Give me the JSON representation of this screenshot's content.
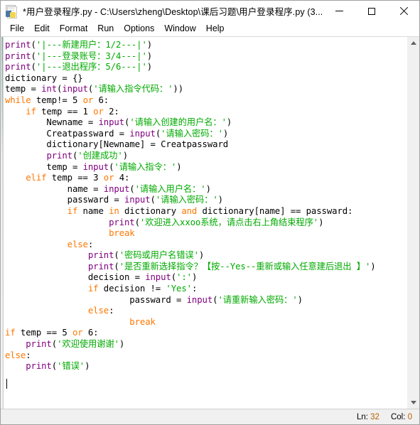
{
  "window": {
    "title": "*用户登录程序.py - C:\\Users\\zheng\\Desktop\\课后习题\\用户登录程序.py (3...",
    "icon": "python-file-icon",
    "controls": {
      "minimize": "minimize-icon",
      "maximize": "maximize-icon",
      "close": "close-icon"
    }
  },
  "menubar": {
    "items": [
      {
        "label": "File"
      },
      {
        "label": "Edit"
      },
      {
        "label": "Format"
      },
      {
        "label": "Run"
      },
      {
        "label": "Options"
      },
      {
        "label": "Window"
      },
      {
        "label": "Help"
      }
    ]
  },
  "editor": {
    "code_lines": [
      "print('|---新建用户：1/2---|')",
      "print('|---登录账号：3/4---|')",
      "print('|---退出程序：5/6---|')",
      "dictionary = {}",
      "temp = int(input('请输入指令代码：'))",
      "while temp!= 5 or 6:",
      "    if temp == 1 or 2:",
      "        Newname = input('请输入创建的用户名：')",
      "        Creatpassward = input('请输入密码：')",
      "        dictionary[Newname] = Creatpassward",
      "        print('创建成功')",
      "        temp = input('请输入指令：')",
      "    elif temp == 3 or 4:",
      "            name = input('请输入用户名：')",
      "            passward = input('请输入密码：')",
      "            if name in dictionary and dictionary[name] == passward:",
      "                    print('欢迎进入xxoo系统，请点击右上角结束程序')",
      "                    break",
      "            else:",
      "                print('密码或用户名错误')",
      "                print('是否重新选择指令？【按--Yes--重新或输入任意建后退出 】')",
      "                decision = input(':')",
      "                if decision != 'Yes':",
      "                        passward = input('请重新输入密码：')",
      "                else:",
      "                        break",
      "if temp == 5 or 6:",
      "    print('欢迎使用谢谢')",
      "else:",
      "    print('错误')"
    ],
    "cursor_visible": true
  },
  "statusbar": {
    "line_label": "Ln:",
    "line_value": "32",
    "col_label": "Col:",
    "col_value": "0"
  },
  "scrollbar": {
    "up_arrow": "scroll-up-icon",
    "down_arrow": "scroll-down-icon"
  },
  "colors": {
    "keyword": "#ff7700",
    "builtin": "#800080",
    "string": "#00aa00",
    "text": "#000000",
    "background": "#ffffff"
  }
}
